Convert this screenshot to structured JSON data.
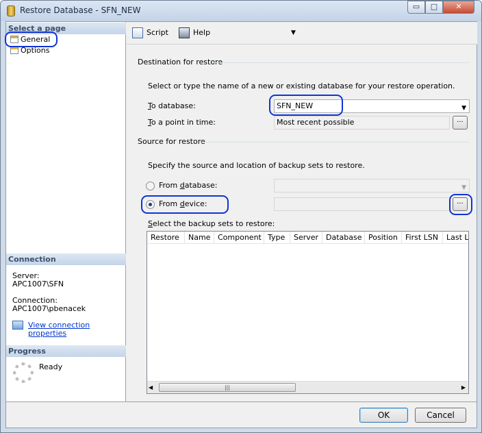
{
  "window": {
    "title": "Restore Database - SFN_NEW",
    "min_glyph": "▭",
    "max_glyph": "□",
    "close_glyph": "✕"
  },
  "left_panel": {
    "select_page_header": "Select a page",
    "pages": [
      {
        "label": "General",
        "icon": "page-icon"
      },
      {
        "label": "Options",
        "icon": "page-icon"
      }
    ],
    "connection_header": "Connection",
    "server_label": "Server:",
    "server_value": "APC1007\\SFN",
    "connection_label": "Connection:",
    "connection_value": "APC1007\\pbenacek",
    "view_connection_link": "View connection properties",
    "progress_header": "Progress",
    "progress_status": "Ready"
  },
  "toolbar": {
    "script_label": "Script",
    "dropdown_glyph": "▼",
    "help_label": "Help"
  },
  "destination": {
    "group_label": "Destination for restore",
    "instruction": "Select or type the name of a new or existing database for your restore operation.",
    "to_database_label_u": "T",
    "to_database_label_rest": "o database:",
    "to_database_value": "SFN_NEW",
    "point_in_time_label_u": "T",
    "point_in_time_label_rest": "o a point in time:",
    "point_in_time_value": "Most recent possible",
    "browse_glyph": "..."
  },
  "source": {
    "group_label": "Source for restore",
    "instruction": "Specify the source and location of backup sets to restore.",
    "from_database_label_a": "From ",
    "from_database_label_u": "d",
    "from_database_label_b": "atabase:",
    "from_device_label_a": "From ",
    "from_device_label_u": "d",
    "from_device_label_b": "evice:",
    "selected_option": "from_device",
    "browse_glyph": "...",
    "backup_sets_label_u": "S",
    "backup_sets_label_rest": "elect the backup sets to restore:"
  },
  "grid": {
    "columns": [
      {
        "label": "Restore"
      },
      {
        "label": "Name"
      },
      {
        "label": "Component"
      },
      {
        "label": "Type"
      },
      {
        "label": "Server"
      },
      {
        "label": "Database"
      },
      {
        "label": "Position"
      },
      {
        "label": "First LSN"
      },
      {
        "label": "Last LSN"
      }
    ],
    "rows": [],
    "scroll_left": "◀",
    "scroll_right": "▶",
    "scroll_grip": "|||"
  },
  "buttons": {
    "ok": "OK",
    "cancel": "Cancel"
  },
  "colors": {
    "highlight": "#0f33d6",
    "link": "#0033cc",
    "section_header": "#3c4f6b"
  }
}
